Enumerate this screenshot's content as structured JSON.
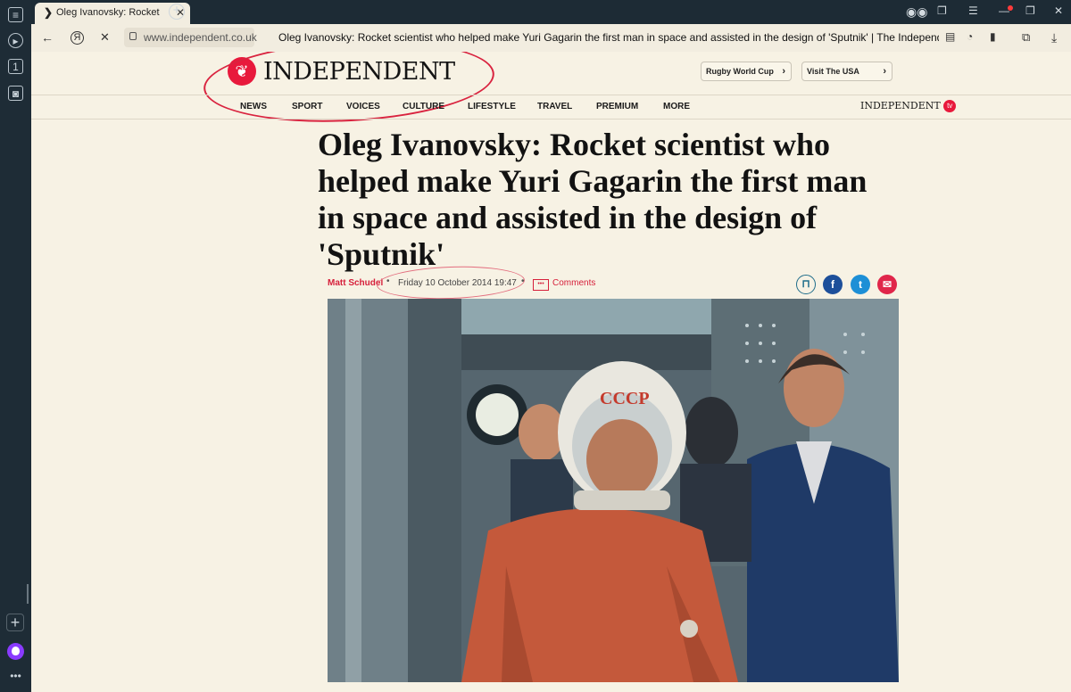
{
  "browser": {
    "tab_title": "Oleg Ivanovsky: Rocket",
    "tab_favicon": "❯",
    "url": "www.independent.co.uk",
    "page_title": "Oleg Ivanovsky: Rocket scientist who helped make Yuri Gagarin the first man in space and assisted in the design of 'Sputnik' | The Independent |",
    "sidebar_badge": "1",
    "accent": "#1d2b35"
  },
  "site": {
    "logo_text": "INDEPENDENT",
    "brand_color": "#e8193c",
    "top_links": [
      "Rugby World Cup",
      "Visit The USA"
    ],
    "nav": [
      "NEWS",
      "SPORT",
      "VOICES",
      "CULTURE",
      "LIFESTYLE",
      "TRAVEL",
      "PREMIUM",
      "MORE"
    ],
    "tv_brand": "INDEPENDENT",
    "tv_badge": "tv"
  },
  "article": {
    "headline": "Oleg Ivanovsky: Rocket scientist who helped make Yuri Gagarin the first man in space and assisted in the design of 'Sputnik'",
    "author": "Matt Schudel",
    "date": "Friday 10 October 2014 19:47",
    "comments_label": "Comments",
    "helmet_text": "СССР"
  },
  "share": {
    "icons": [
      "bookmark-icon",
      "facebook-icon",
      "twitter-icon",
      "email-icon"
    ],
    "facebook_glyph": "f",
    "twitter_glyph": "t",
    "email_glyph": "✉",
    "bookmark_glyph": "⊓"
  }
}
